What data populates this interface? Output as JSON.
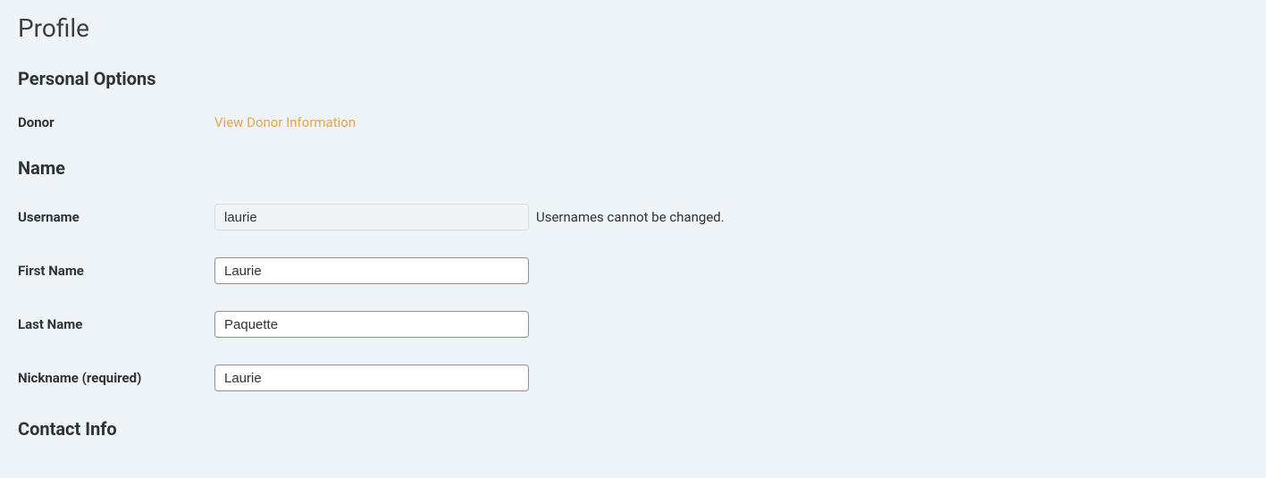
{
  "page": {
    "title": "Profile"
  },
  "sections": {
    "personal_options": {
      "heading": "Personal Options",
      "donor": {
        "label": "Donor",
        "link_text": "View Donor Information"
      }
    },
    "name": {
      "heading": "Name",
      "username": {
        "label": "Username",
        "value": "laurie",
        "hint": "Usernames cannot be changed."
      },
      "first_name": {
        "label": "First Name",
        "value": "Laurie"
      },
      "last_name": {
        "label": "Last Name",
        "value": "Paquette"
      },
      "nickname": {
        "label": "Nickname (required)",
        "value": "Laurie"
      }
    },
    "contact_info": {
      "heading": "Contact Info"
    }
  }
}
